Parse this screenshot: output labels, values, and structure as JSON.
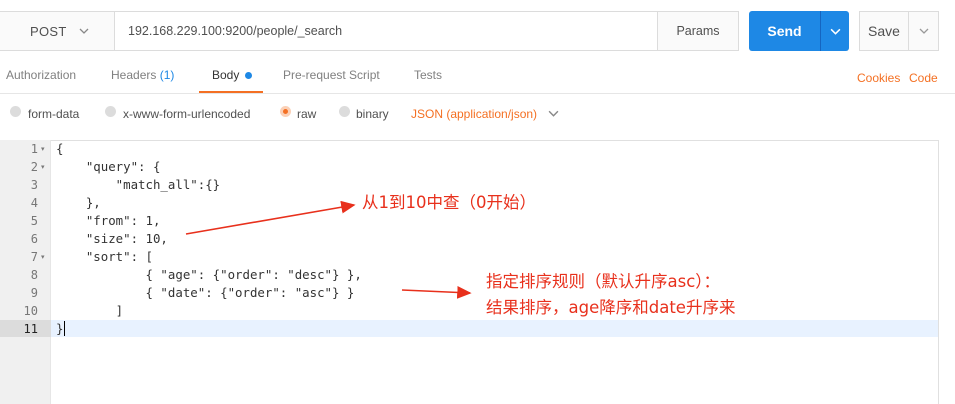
{
  "request": {
    "method": "POST",
    "url": "192.168.229.100:9200/people/_search",
    "params_label": "Params",
    "send_label": "Send",
    "save_label": "Save"
  },
  "tabs": {
    "authorization": "Authorization",
    "headers": "Headers",
    "headers_count": "(1)",
    "body": "Body",
    "prerequest": "Pre-request Script",
    "tests": "Tests",
    "cookies": "Cookies",
    "code": "Code"
  },
  "body_options": {
    "form_data": "form-data",
    "urlencoded": "x-www-form-urlencoded",
    "raw": "raw",
    "binary": "binary",
    "content_type": "JSON (application/json)",
    "selected": "raw"
  },
  "editor": {
    "line_numbers": [
      "1",
      "2",
      "3",
      "4",
      "5",
      "6",
      "7",
      "8",
      "9",
      "10",
      "11"
    ],
    "lines": [
      "{",
      "    \"query\": {",
      "        \"match_all\":{}",
      "    },",
      "    \"from\": 1,",
      "    \"size\": 10,",
      "    \"sort\": [",
      "            { \"age\": {\"order\": \"desc\"} },",
      "            { \"date\": {\"order\": \"asc\"} }",
      "        ]",
      "}"
    ],
    "active_line": 11
  },
  "annotations": {
    "note1": "从1到10中查（0开始）",
    "note2_line1": "指定排序规则（默认升序asc）：",
    "note2_line2": "结果排序，age降序和date升序来"
  },
  "colors": {
    "accent": "#f47023",
    "send": "#1e88e5",
    "annotation": "#e8301c"
  }
}
